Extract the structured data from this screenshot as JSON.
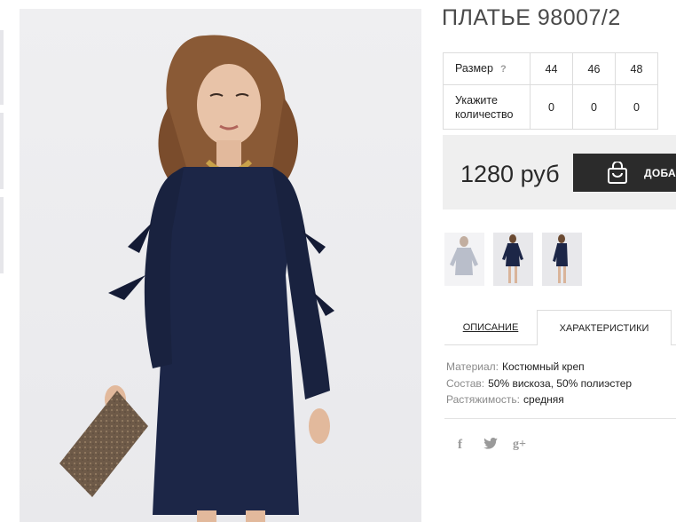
{
  "product": {
    "title": "ПЛАТЬЕ 98007/2"
  },
  "size_table": {
    "size_label": "Размер",
    "help_mark": "?",
    "sizes": [
      "44",
      "46",
      "48"
    ],
    "qty_label": "Укажите количество",
    "quantities": [
      "0",
      "0",
      "0"
    ]
  },
  "purchase": {
    "price": "1280 руб",
    "add_button_label": "ДОБАВИ",
    "button_icon": "shopping-bag-icon",
    "button_color": "#2b2b2b"
  },
  "thumbnails": [
    {
      "alt": "front view"
    },
    {
      "alt": "full length"
    },
    {
      "alt": "side view"
    }
  ],
  "tabs": {
    "description": "ОПИСАНИЕ",
    "specs": "ХАРАКТЕРИСТИКИ",
    "active": "specs"
  },
  "specs": [
    {
      "key": "Материал:",
      "value": "Костюмный креп"
    },
    {
      "key": "Состав:",
      "value": "50% вискоза, 50% полиэстер"
    },
    {
      "key": "Растяжимость:",
      "value": "средняя"
    }
  ],
  "social": {
    "facebook": "f",
    "twitter_icon": "twitter-bird-icon",
    "googleplus": "g+"
  },
  "colors": {
    "dress": "#1c2647",
    "background": "#ededf0"
  }
}
